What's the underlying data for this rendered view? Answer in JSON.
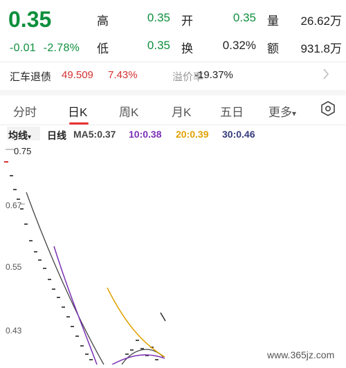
{
  "quote": {
    "price": "0.35",
    "change": "-0.01",
    "change_pct": "-2.78%",
    "high_label": "高",
    "high": "0.35",
    "open_label": "开",
    "open": "0.35",
    "volume_label": "量",
    "volume": "26.62万",
    "low_label": "低",
    "low": "0.35",
    "turnover_label": "换",
    "turnover": "0.32%",
    "amount_label": "额",
    "amount": "931.8万"
  },
  "bond": {
    "name": "汇车退债",
    "price": "49.509",
    "pct": "7.43%",
    "premium_label": "溢价率",
    "premium": "-19.37%"
  },
  "tabs": [
    "分时",
    "日K",
    "周K",
    "月K",
    "五日",
    "更多"
  ],
  "ma_bar": {
    "selector": "均线",
    "selector_arrow": "▾",
    "period": "日线",
    "ma5": "MA5:0.37",
    "ma10": "10:0.38",
    "ma20": "20:0.39",
    "ma30": "30:0.46"
  },
  "chart": {
    "top_label": "0.75",
    "yticks": [
      "0.67",
      "0.55",
      "0.43"
    ]
  },
  "colors": {
    "green": "#0d8f3c",
    "red": "#d43030",
    "ma10": "#7b2fb5",
    "ma20": "#e0a100",
    "ma30": "#333a7a",
    "ma5": "#444444"
  },
  "icons": {
    "more_tab_arrow": "▾",
    "bond_arrow": "chevron-right-icon",
    "settings": "hexagon-settings-icon"
  },
  "watermark": "www.365jz.com"
}
